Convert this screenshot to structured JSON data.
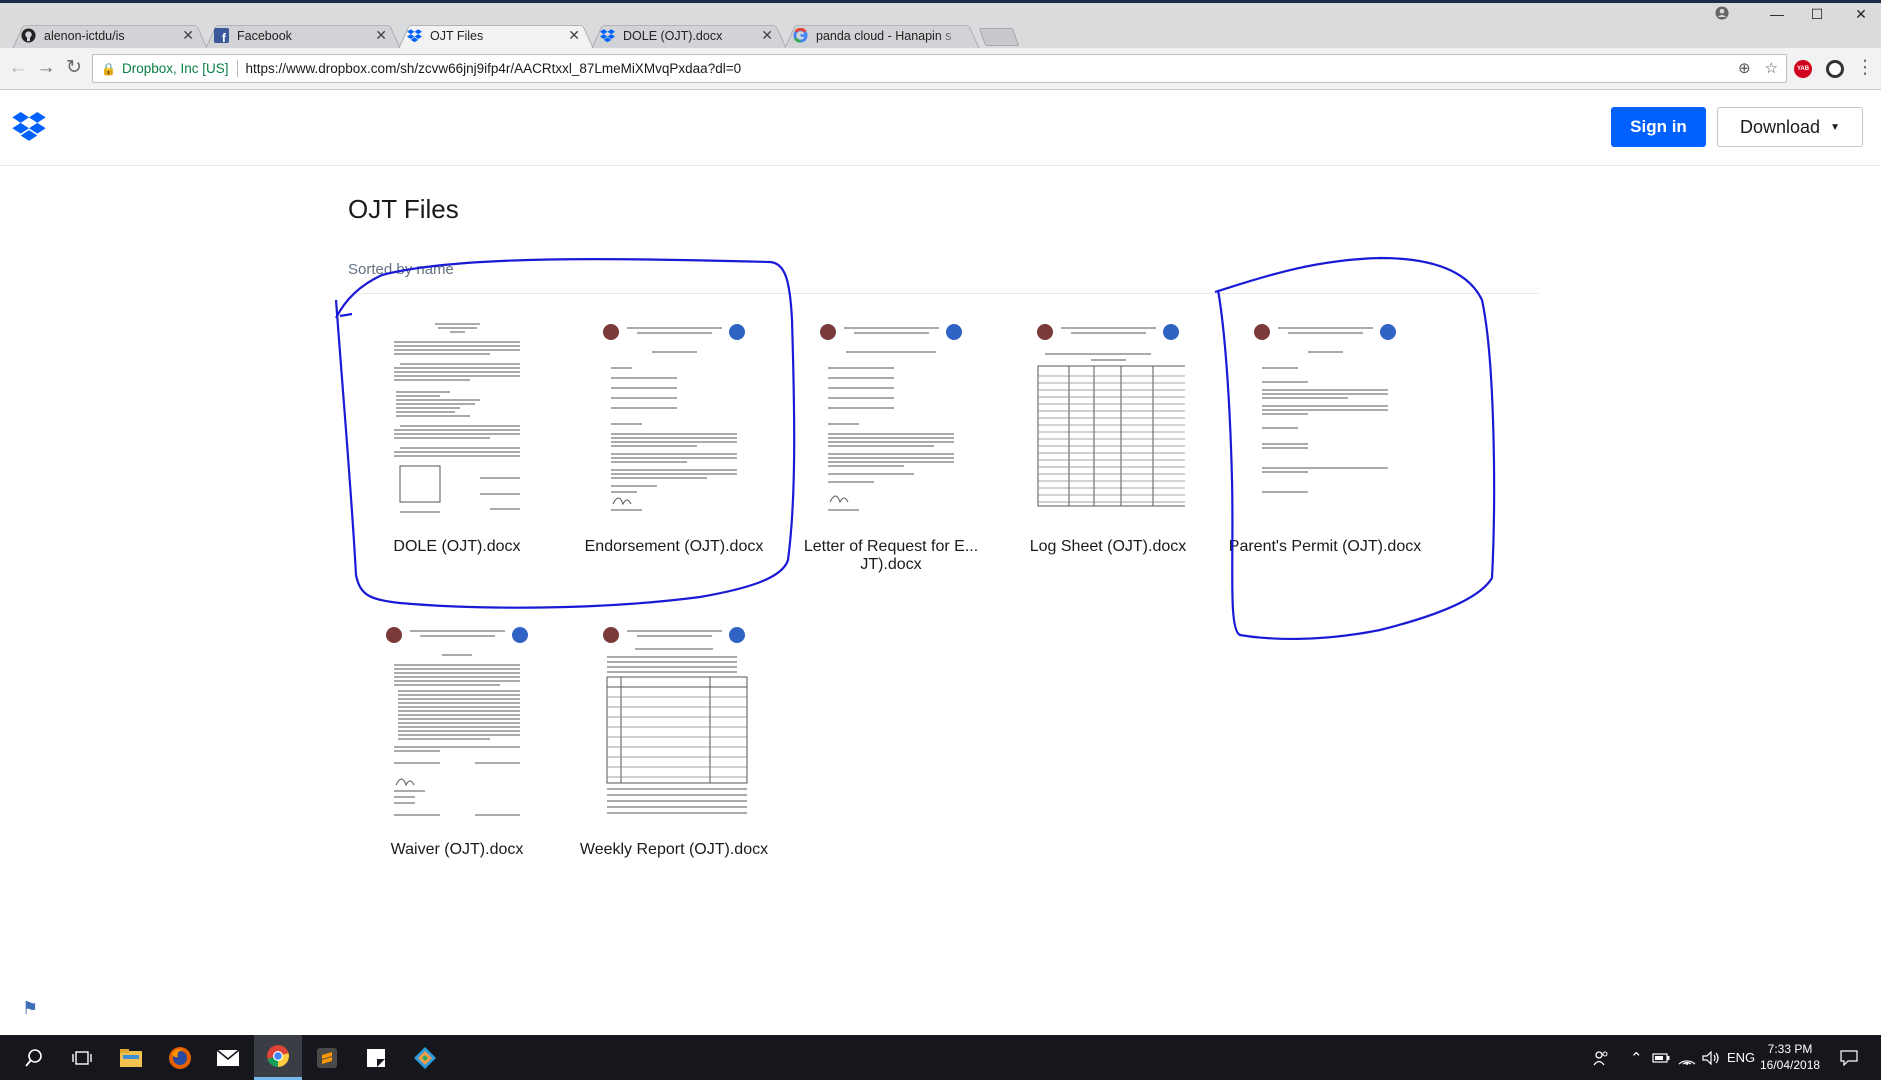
{
  "browser": {
    "tabs": [
      {
        "label": "alenon-ictdu/is",
        "icon": "github-icon"
      },
      {
        "label": "Facebook",
        "icon": "facebook-icon"
      },
      {
        "label": "OJT Files",
        "icon": "dropbox-icon",
        "active": true
      },
      {
        "label": "DOLE (OJT).docx",
        "icon": "dropbox-icon"
      },
      {
        "label": "panda cloud - Hanapin s",
        "icon": "google-icon"
      }
    ],
    "address": {
      "secure_label": "Dropbox, Inc [US]",
      "url": "https://www.dropbox.com/sh/zcvw66jnj9ifp4r/AACRtxxl_87LmeMiXMvqPxdaa?dl=0"
    },
    "extension_badge": "YAB"
  },
  "header": {
    "signin_label": "Sign in",
    "download_label": "Download"
  },
  "folder": {
    "title": "OJT Files",
    "sort_label": "Sorted by name",
    "files": [
      {
        "name": "DOLE (OJT).docx"
      },
      {
        "name": "Endorsement (OJT).docx"
      },
      {
        "name_line1": "Letter of Request for E...",
        "name_line2": "JT).docx"
      },
      {
        "name": "Log Sheet (OJT).docx"
      },
      {
        "name": "Parent's Permit (OJT).docx"
      },
      {
        "name": "Waiver (OJT).docx"
      },
      {
        "name": "Weekly Report (OJT).docx"
      }
    ]
  },
  "taskbar": {
    "language": "ENG",
    "time": "7:33 PM",
    "date": "16/04/2018"
  },
  "colors": {
    "dropbox_blue": "#0061fe",
    "annotation_blue": "#1a1ad6",
    "taskbar": "#15171c"
  }
}
